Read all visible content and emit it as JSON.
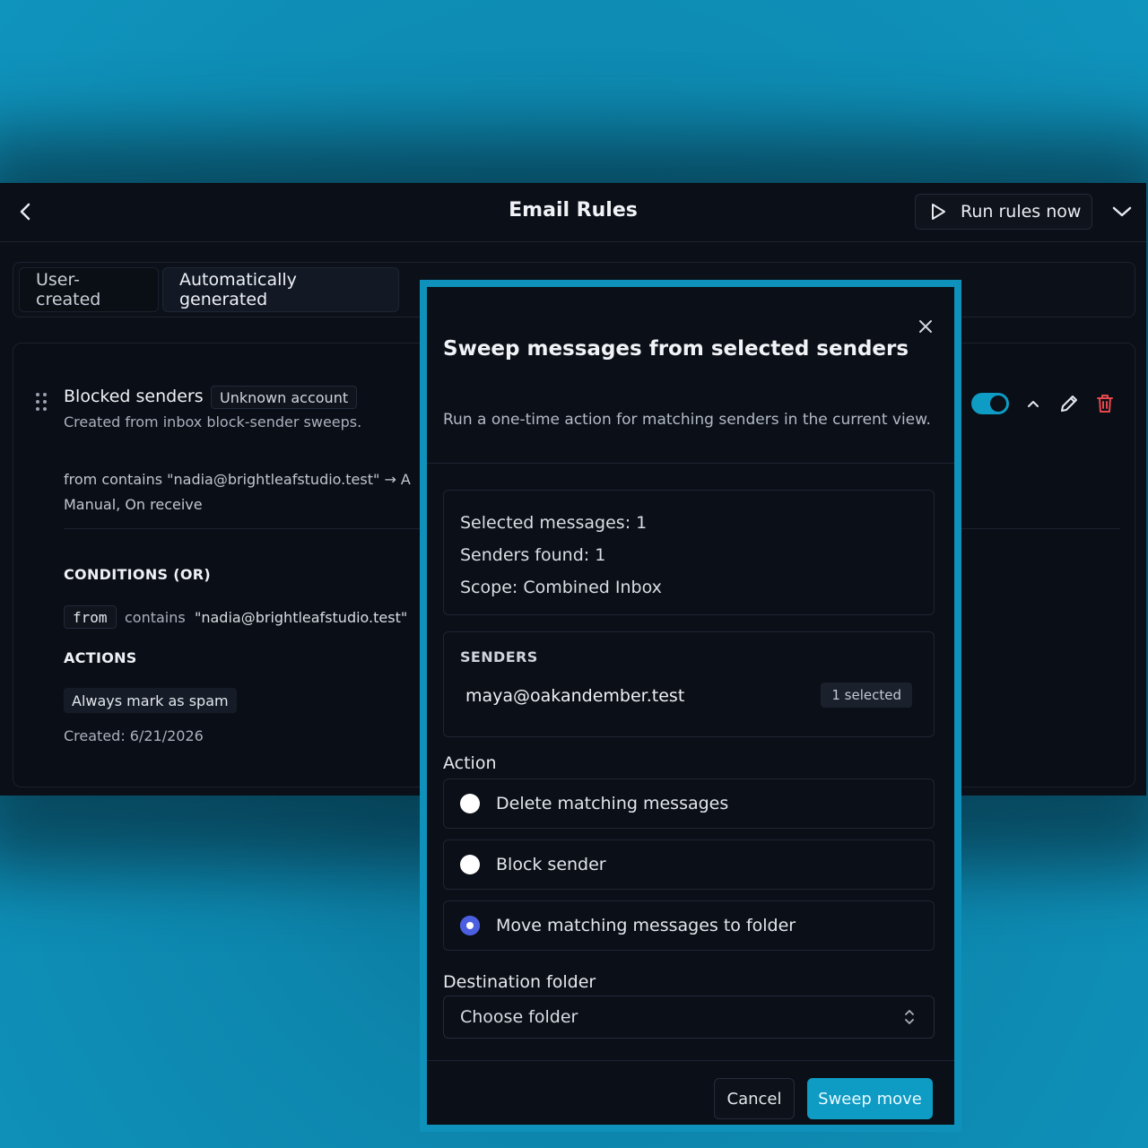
{
  "app": {
    "title": "Email Rules",
    "run_rules_label": "Run rules now"
  },
  "tabs": [
    {
      "label": "User-created"
    },
    {
      "label": "Automatically generated"
    }
  ],
  "rule": {
    "name": "Blocked senders",
    "badge": "Unknown account",
    "description": "Created from inbox block-sender sweeps.",
    "summary": "from contains \"nadia@brightleafstudio.test\"  →  A",
    "trigger": "Manual, On receive",
    "conditions_heading": "CONDITIONS (OR)",
    "condition": {
      "field": "from",
      "operator": "contains",
      "value": "\"nadia@brightleafstudio.test\""
    },
    "actions_heading": "ACTIONS",
    "action": "Always mark as spam",
    "created": "Created: 6/21/2026",
    "enabled": true
  },
  "modal": {
    "title": "Sweep messages from selected senders",
    "subtitle": "Run a one-time action for matching senders in the current view.",
    "summary": {
      "selected_messages": "Selected messages: 1",
      "senders_found": "Senders found: 1",
      "scope": "Scope: Combined Inbox"
    },
    "senders_heading": "SENDERS",
    "sender_email": "maya@oakandember.test",
    "sender_badge": "1 selected",
    "action_label": "Action",
    "options": [
      {
        "label": "Delete matching messages",
        "checked": false
      },
      {
        "label": "Block sender",
        "checked": false
      },
      {
        "label": "Move matching messages to folder",
        "checked": true
      }
    ],
    "destination_label": "Destination folder",
    "destination_placeholder": "Choose folder",
    "cancel_label": "Cancel",
    "confirm_label": "Sweep move"
  },
  "colors": {
    "accent": "#0e9bc4",
    "radio_checked": "#4b5fe0",
    "danger": "#e5484d",
    "background": "#0b0f17"
  }
}
